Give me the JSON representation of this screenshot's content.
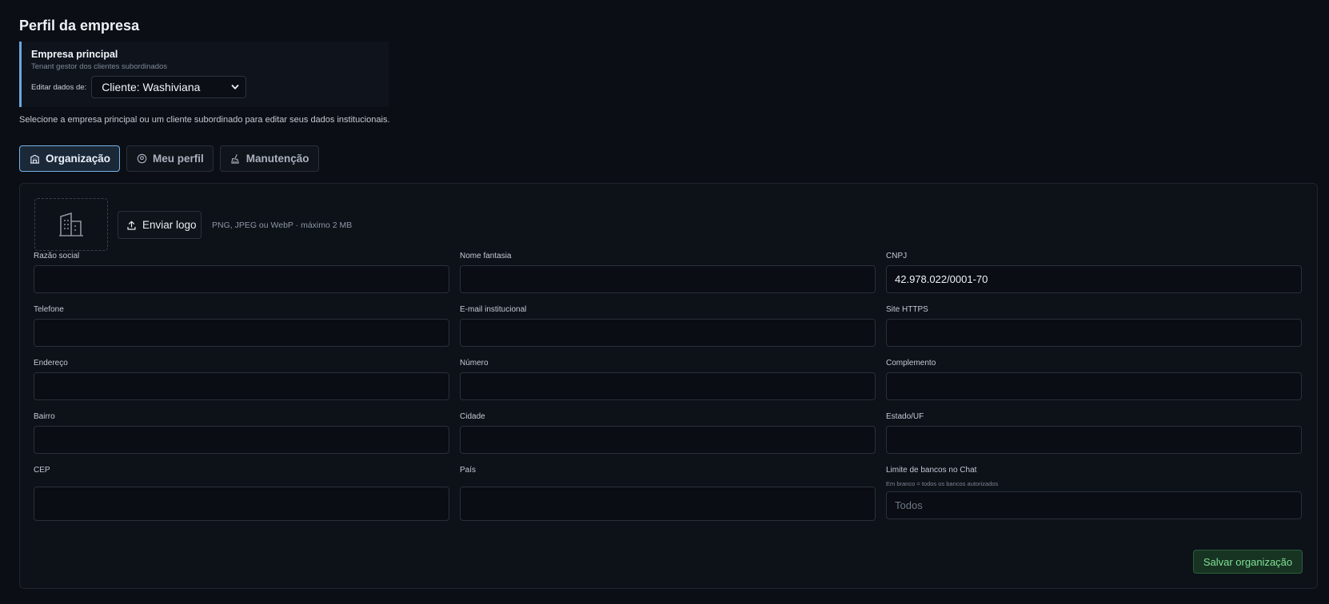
{
  "page": {
    "title": "Perfil da empresa"
  },
  "tenant": {
    "title": "Empresa principal",
    "subtitle": "Tenant gestor dos clientes subordinados",
    "edit_label": "Editar dados de:",
    "selected": "Cliente: Washiviana"
  },
  "hint": "Selecione a empresa principal ou um cliente subordinado para editar seus dados institucionais.",
  "tabs": [
    {
      "label": "Organização",
      "icon": "building-icon",
      "active": true
    },
    {
      "label": "Meu perfil",
      "icon": "user-circle-icon",
      "active": false
    },
    {
      "label": "Manutenção",
      "icon": "broom-icon",
      "active": false
    }
  ],
  "logo": {
    "upload_label": "Enviar logo",
    "hint": "PNG, JPEG ou WebP · máximo 2 MB"
  },
  "fields": {
    "razao_social": {
      "label": "Razão social",
      "value": ""
    },
    "nome_fantasia": {
      "label": "Nome fantasia",
      "value": ""
    },
    "cnpj": {
      "label": "CNPJ",
      "value": "42.978.022/0001-70"
    },
    "telefone": {
      "label": "Telefone",
      "value": ""
    },
    "email": {
      "label": "E-mail institucional",
      "value": ""
    },
    "site": {
      "label": "Site HTTPS",
      "value": ""
    },
    "endereco": {
      "label": "Endereço",
      "value": ""
    },
    "numero": {
      "label": "Número",
      "value": ""
    },
    "complemento": {
      "label": "Complemento",
      "value": ""
    },
    "bairro": {
      "label": "Bairro",
      "value": ""
    },
    "cidade": {
      "label": "Cidade",
      "value": ""
    },
    "estado": {
      "label": "Estado/UF",
      "value": ""
    },
    "cep": {
      "label": "CEP",
      "value": ""
    },
    "pais": {
      "label": "País",
      "value": ""
    },
    "limite_bancos": {
      "label": "Limite de bancos no Chat",
      "sublabel": "Em branco = todos os bancos autorizados",
      "placeholder": "Todos",
      "value": ""
    }
  },
  "save_label": "Salvar organização",
  "colors": {
    "accent": "#6aa7e0",
    "save": "#7fe195",
    "background": "#0b0e14"
  }
}
